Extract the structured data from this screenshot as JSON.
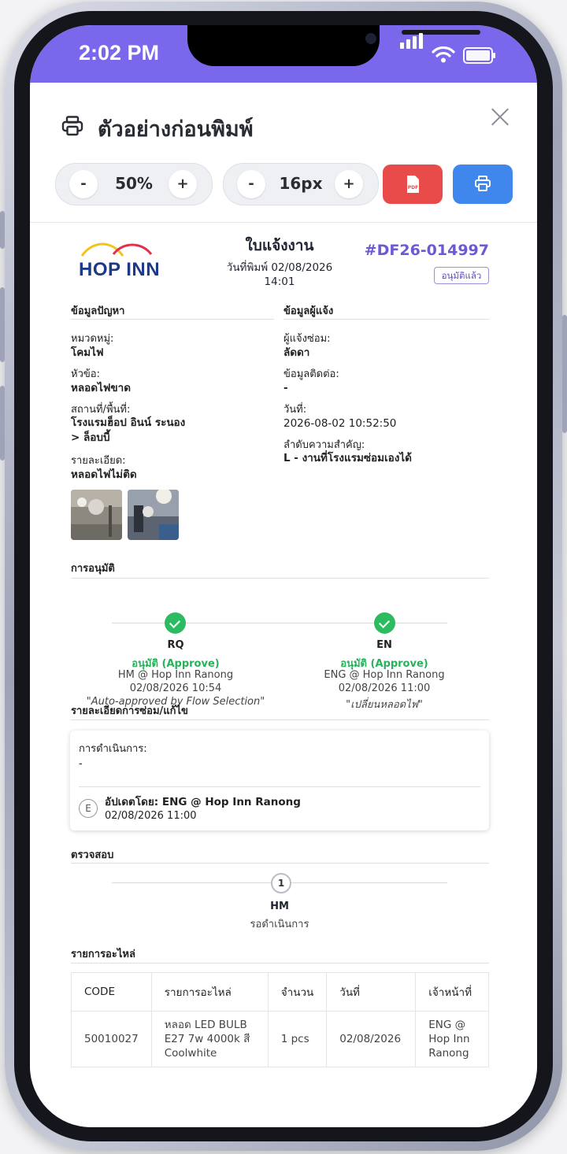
{
  "status_bar": {
    "time": "2:02 PM"
  },
  "modal": {
    "title": "ตัวอย่างก่อนพิมพ์",
    "zoom": {
      "minus": "-",
      "value": "50%",
      "plus": "+"
    },
    "font_size": {
      "minus": "-",
      "value": "16px",
      "plus": "+"
    },
    "pdf_label": "PDF"
  },
  "doc": {
    "logo_text": "HOP INN",
    "title": "ใบแจ้งงาน",
    "print_date_line1": "วันที่พิมพ์ 02/08/2026",
    "print_date_line2": "14:01",
    "number": "#DF26-014997",
    "status": "อนุมัติแล้ว",
    "problem": {
      "heading": "ข้อมูลปัญหา",
      "category_label": "หมวดหมู่:",
      "category_value": "โคมไฟ",
      "topic_label": "หัวข้อ:",
      "topic_value": "หลอดไฟขาด",
      "location_label": "สถานที่/พื้นที่:",
      "location_value_1": "โรงแรมฮ็อป อินน์ ระนอง",
      "location_value_2": "> ล็อบบี้",
      "detail_label": "รายละเอียด:",
      "detail_value": "หลอดไฟไม่ติด"
    },
    "reporter": {
      "heading": "ข้อมูลผู้แจ้ง",
      "reporter_label": "ผู้แจ้งซ่อม:",
      "reporter_value": "ลัดดา",
      "contact_label": "ข้อมูลติดต่อ:",
      "contact_value": "-",
      "date_label": "วันที่:",
      "date_value": "2026-08-02 10:52:50",
      "priority_label": "ลำดับความสำคัญ:",
      "priority_value": "L - งานที่โรงแรมซ่อมเองได้"
    },
    "approval": {
      "heading": "การอนุมัติ",
      "steps": [
        {
          "code": "RQ",
          "status": "อนุมัติ (Approve)",
          "by": "HM @ Hop Inn Ranong",
          "date": "02/08/2026 10:54",
          "note": "\"Auto-approved by Flow Selection\""
        },
        {
          "code": "EN",
          "status": "อนุมัติ (Approve)",
          "by": "ENG @ Hop Inn Ranong",
          "date": "02/08/2026 11:00",
          "note": "\"เปลี่ยนหลอดไฟ\""
        }
      ]
    },
    "repair": {
      "heading": "รายละเอียดการซ่อม/แก้ไข",
      "action_label": "การดำเนินการ:",
      "action_value": "-",
      "avatar_letter": "E",
      "updated_by": "อัปเดตโดย: ENG @ Hop Inn Ranong",
      "updated_at": "02/08/2026 11:00"
    },
    "inspection": {
      "heading": "ตรวจสอบ",
      "step_number": "1",
      "role": "HM",
      "status": "รอดำเนินการ"
    },
    "parts": {
      "heading": "รายการอะไหล่",
      "columns": [
        "CODE",
        "รายการอะไหล่",
        "จำนวน",
        "วันที่",
        "เจ้าหน้าที่"
      ],
      "rows": [
        {
          "code": "50010027",
          "item_1": "หลอด LED BULB",
          "item_2": "E27 7w 4000k สี",
          "item_3": "Coolwhite",
          "qty": "1 pcs",
          "date": "02/08/2026",
          "staff_1": "ENG @",
          "staff_2": "Hop Inn",
          "staff_3": "Ranong"
        }
      ]
    }
  },
  "colors": {
    "accent": "#7a68ec",
    "approve": "#2dbb61",
    "pdf": "#e94b4b",
    "print": "#3f87ec",
    "doc_number": "#6d58d8"
  }
}
